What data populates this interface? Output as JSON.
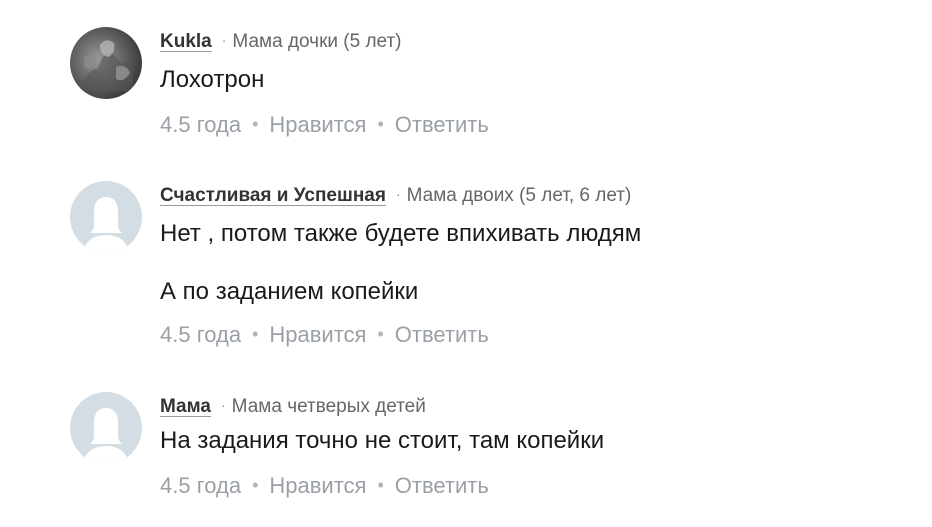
{
  "comments": [
    {
      "author": "Kukla",
      "status": "Мама дочки (5 лет)",
      "texts": [
        "Лохотрон"
      ],
      "time": "4.5 года",
      "like": "Нравится",
      "reply": "Ответить",
      "avatar": "user-photo"
    },
    {
      "author": "Счастливая и Успешная",
      "status": "Мама двоих (5 лет, 6 лет)",
      "texts": [
        "Нет , потом также будете впихивать людям",
        "А по заданием копейки"
      ],
      "time": "4.5 года",
      "like": "Нравится",
      "reply": "Ответить",
      "avatar": "default-user-silhouette"
    },
    {
      "author": "Мама",
      "status": "Мама четверых детей",
      "texts": [
        "На задания точно не стоит, там копейки"
      ],
      "time": "4.5 года",
      "like": "Нравится",
      "reply": "Ответить",
      "avatar": "default-user-silhouette"
    }
  ],
  "separator": "·",
  "action_separator": "•",
  "colors": {
    "author": "#333333",
    "meta": "#666666",
    "actions": "#9aa0a6",
    "placeholder_avatar_bg": "#d4dde3",
    "placeholder_avatar_fg": "#ffffff"
  }
}
